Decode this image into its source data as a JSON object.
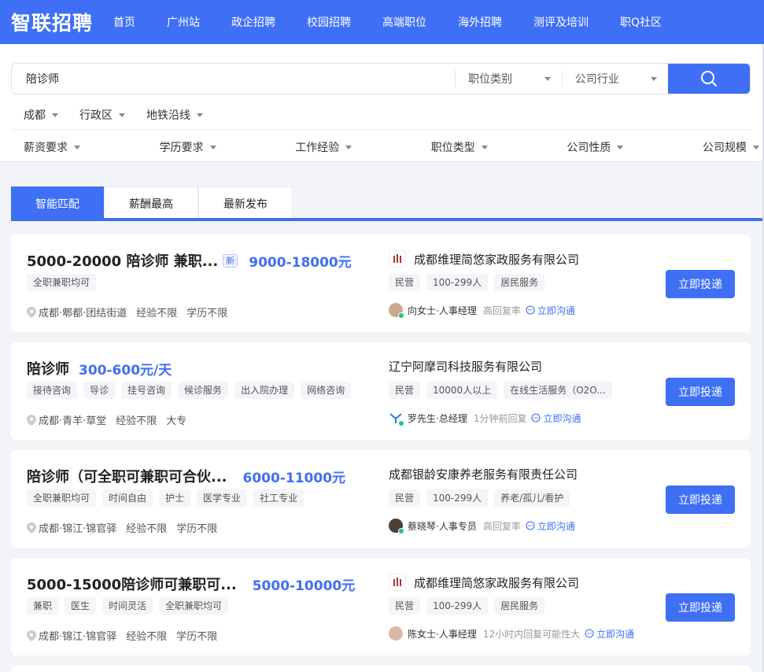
{
  "brand": {
    "logo_text": "智联招聘",
    "accent": "#3f6ff5"
  },
  "nav": [
    "首页",
    "广州站",
    "政企招聘",
    "校园招聘",
    "高端职位",
    "海外招聘",
    "测评及培训",
    "职Q社区"
  ],
  "search": {
    "query": "陪诊师",
    "job_category": "职位类别",
    "industry": "公司行业",
    "button_icon": "search-icon"
  },
  "location_filters": [
    "成都",
    "行政区",
    "地铁沿线"
  ],
  "filters": [
    "薪资要求",
    "学历要求",
    "工作经验",
    "职位类型",
    "公司性质",
    "公司规模"
  ],
  "sort_tabs": [
    "智能匹配",
    "薪酬最高",
    "最新发布"
  ],
  "jobs": [
    {
      "title": "5000-20000 陪诊师 兼职...",
      "new_badge": "新",
      "salary": "9000-18000元",
      "tags": [
        "全职兼职均可"
      ],
      "location": "成都·郫都·团结街道",
      "experience": "经验不限",
      "education": "学历不限",
      "company": "成都维理简悠家政服务有限公司",
      "company_tags": [
        "民营",
        "100-299人",
        "居民服务"
      ],
      "recruiter": "向女士·人事经理",
      "reply": "高回复率",
      "chat": "立即沟通",
      "apply": "立即投递"
    },
    {
      "title": "陪诊师",
      "salary": "300-600元/天",
      "tags": [
        "接待咨询",
        "导诊",
        "挂号咨询",
        "候诊服务",
        "出入院办理",
        "网络咨询"
      ],
      "location": "成都·青羊·草堂",
      "experience": "经验不限",
      "education": "大专",
      "company": "辽宁阿摩司科技服务有限公司",
      "company_tags": [
        "民营",
        "10000人以上",
        "在线生活服务（O2O..."
      ],
      "recruiter": "罗先生·总经理",
      "reply": "1分钟前回复",
      "chat": "立即沟通",
      "apply": "立即投递"
    },
    {
      "title": "陪诊师（可全职可兼职可合伙...",
      "salary": "6000-11000元",
      "tags": [
        "全职兼职均可",
        "时间自由",
        "护士",
        "医学专业",
        "社工专业"
      ],
      "location": "成都·锦江·锦官驿",
      "experience": "经验不限",
      "education": "学历不限",
      "company": "成都银龄安康养老服务有限责任公司",
      "company_tags": [
        "民营",
        "100-299人",
        "养老/孤儿/看护"
      ],
      "recruiter": "蔡晓琴·人事专员",
      "reply": "高回复率",
      "chat": "立即沟通",
      "apply": "立即投递"
    },
    {
      "title": "5000-15000陪诊师可兼职可...",
      "salary": "5000-10000元",
      "tags": [
        "兼职",
        "医生",
        "时间灵活",
        "全职兼职均可"
      ],
      "location": "成都·锦江·锦官驿",
      "experience": "经验不限",
      "education": "学历不限",
      "company": "成都维理简悠家政服务有限公司",
      "company_tags": [
        "民营",
        "100-299人",
        "居民服务"
      ],
      "recruiter": "陈女士·人事经理",
      "reply": "12小时内回复可能性大",
      "chat": "立即沟通",
      "apply": "立即投递"
    }
  ]
}
